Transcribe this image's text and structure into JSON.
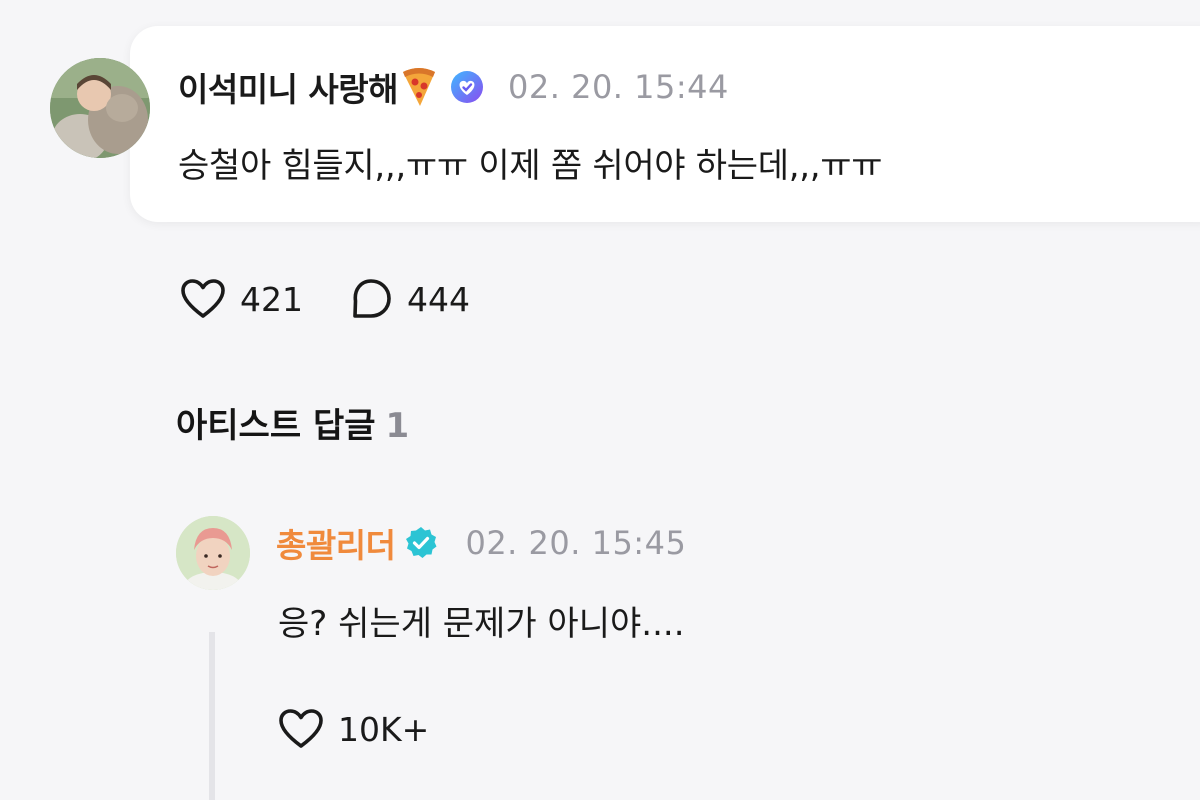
{
  "post": {
    "author": "이석미니 사랑해",
    "author_emoji_icon": "pizza-icon",
    "badge_icon": "heart-badge-icon",
    "timestamp": "02. 20. 15:44",
    "text": "승철아 힘들지,,,ㅠㅠ 이제 쫌 쉬어야 하는데,,,ㅠㅠ",
    "likes": "421",
    "comments": "444"
  },
  "replies_section": {
    "title": "아티스트 답글",
    "count": "1"
  },
  "artist_reply": {
    "author": "총괄리더",
    "badge_icon": "verified-badge-icon",
    "timestamp": "02. 20. 15:45",
    "text": "응? 쉬는게 문제가 아니야....",
    "likes": "10K+"
  },
  "colors": {
    "artist_name": "#f08a3c",
    "artist_badge": "#2cc4d4",
    "fan_badge": "#6a5cf0",
    "timestamp": "#9a9aa2"
  }
}
